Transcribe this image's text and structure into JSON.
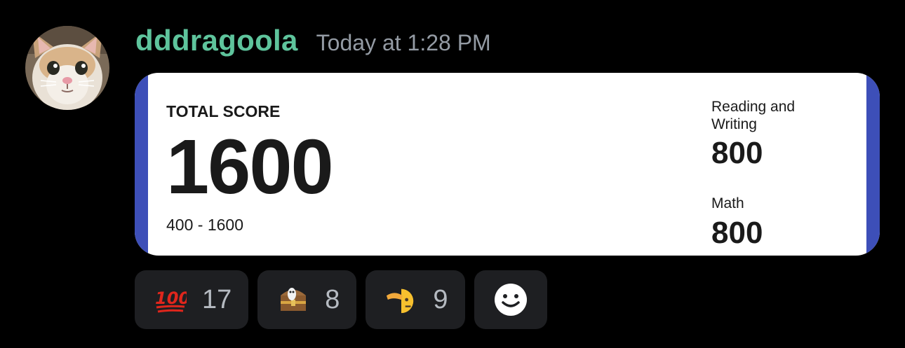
{
  "message": {
    "author": "dddragoola",
    "timestamp": "Today at 1:28 PM",
    "avatar_icon": "cat-avatar"
  },
  "score_report": {
    "total_label": "TOTAL SCORE",
    "total_value": "1600",
    "total_range": "400 - 1600",
    "sections": [
      {
        "label": "Reading and Writing",
        "value": "800"
      },
      {
        "label": "Math",
        "value": "800"
      }
    ],
    "accent_color": "#3d4fb8"
  },
  "reactions": [
    {
      "icon": "hundred-points-icon",
      "count": "17"
    },
    {
      "icon": "treasure-chest-emoji-icon",
      "count": "8"
    },
    {
      "icon": "saluting-face-icon",
      "count": "9"
    }
  ],
  "add_reaction": {
    "icon": "smiley-face-icon"
  },
  "colors": {
    "background": "#000000",
    "username": "#5ec49c",
    "timestamp": "#949ba4",
    "reaction_bg": "#1e1f22",
    "reaction_count": "#b5bac1"
  }
}
